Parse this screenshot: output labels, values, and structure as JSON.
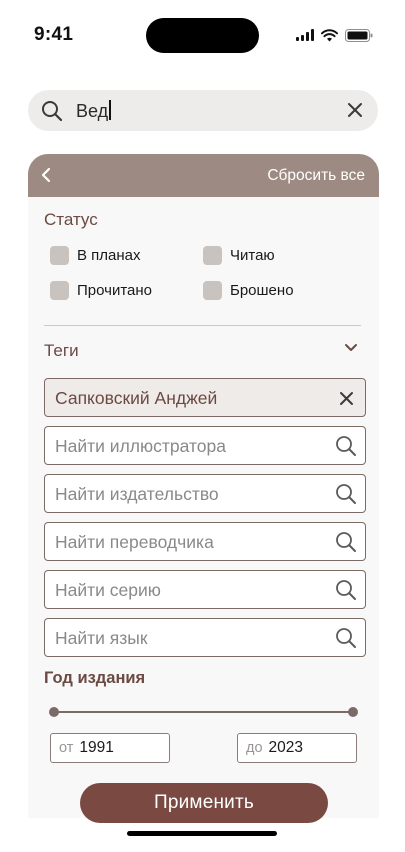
{
  "status_bar": {
    "time": "9:41"
  },
  "search": {
    "value": "Вед"
  },
  "filter_panel": {
    "reset_label": "Сбросить все",
    "status_section": {
      "title": "Статус",
      "options": [
        {
          "label": "В планах",
          "checked": false
        },
        {
          "label": "Читаю",
          "checked": false
        },
        {
          "label": "Прочитано",
          "checked": false
        },
        {
          "label": "Брошено",
          "checked": false
        }
      ]
    },
    "tags_section": {
      "title": "Теги",
      "selected_author": "Сапковский Анджей",
      "search_fields": [
        {
          "placeholder": "Найти иллюстратора"
        },
        {
          "placeholder": "Найти издательство"
        },
        {
          "placeholder": "Найти переводчика"
        },
        {
          "placeholder": "Найти серию"
        },
        {
          "placeholder": "Найти язык"
        }
      ]
    },
    "year_section": {
      "title": "Год издания",
      "from_prefix": "от",
      "from_value": "1991",
      "to_prefix": "до",
      "to_value": "2023"
    },
    "apply_label": "Применить"
  },
  "colors": {
    "header": "#9d8b83",
    "accent_text": "#6b4a43",
    "button": "#7a4a42",
    "panel_bg": "#f8f8f8",
    "search_bg": "#eeecea"
  }
}
